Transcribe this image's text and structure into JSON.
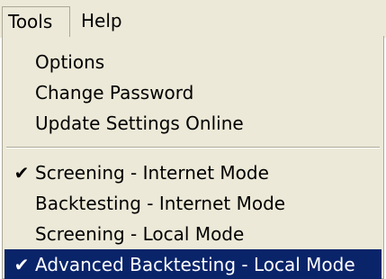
{
  "menubar": {
    "tools_label": "Tools",
    "help_label": "Help"
  },
  "menu": {
    "items": [
      {
        "label": "Options",
        "checked": false,
        "highlighted": false
      },
      {
        "label": "Change Password",
        "checked": false,
        "highlighted": false
      },
      {
        "label": "Update Settings Online",
        "checked": false,
        "highlighted": false
      },
      {
        "label": "Screening - Internet Mode",
        "checked": true,
        "highlighted": false
      },
      {
        "label": "Backtesting - Internet Mode",
        "checked": false,
        "highlighted": false
      },
      {
        "label": "Screening - Local Mode",
        "checked": false,
        "highlighted": false
      },
      {
        "label": "Advanced Backtesting - Local Mode",
        "checked": true,
        "highlighted": true
      }
    ],
    "check_glyph": "✔"
  },
  "colors": {
    "menu_background": "#ece9d8",
    "highlight_background": "#0a246a",
    "highlight_text": "#ffffff",
    "border": "#aca899"
  }
}
